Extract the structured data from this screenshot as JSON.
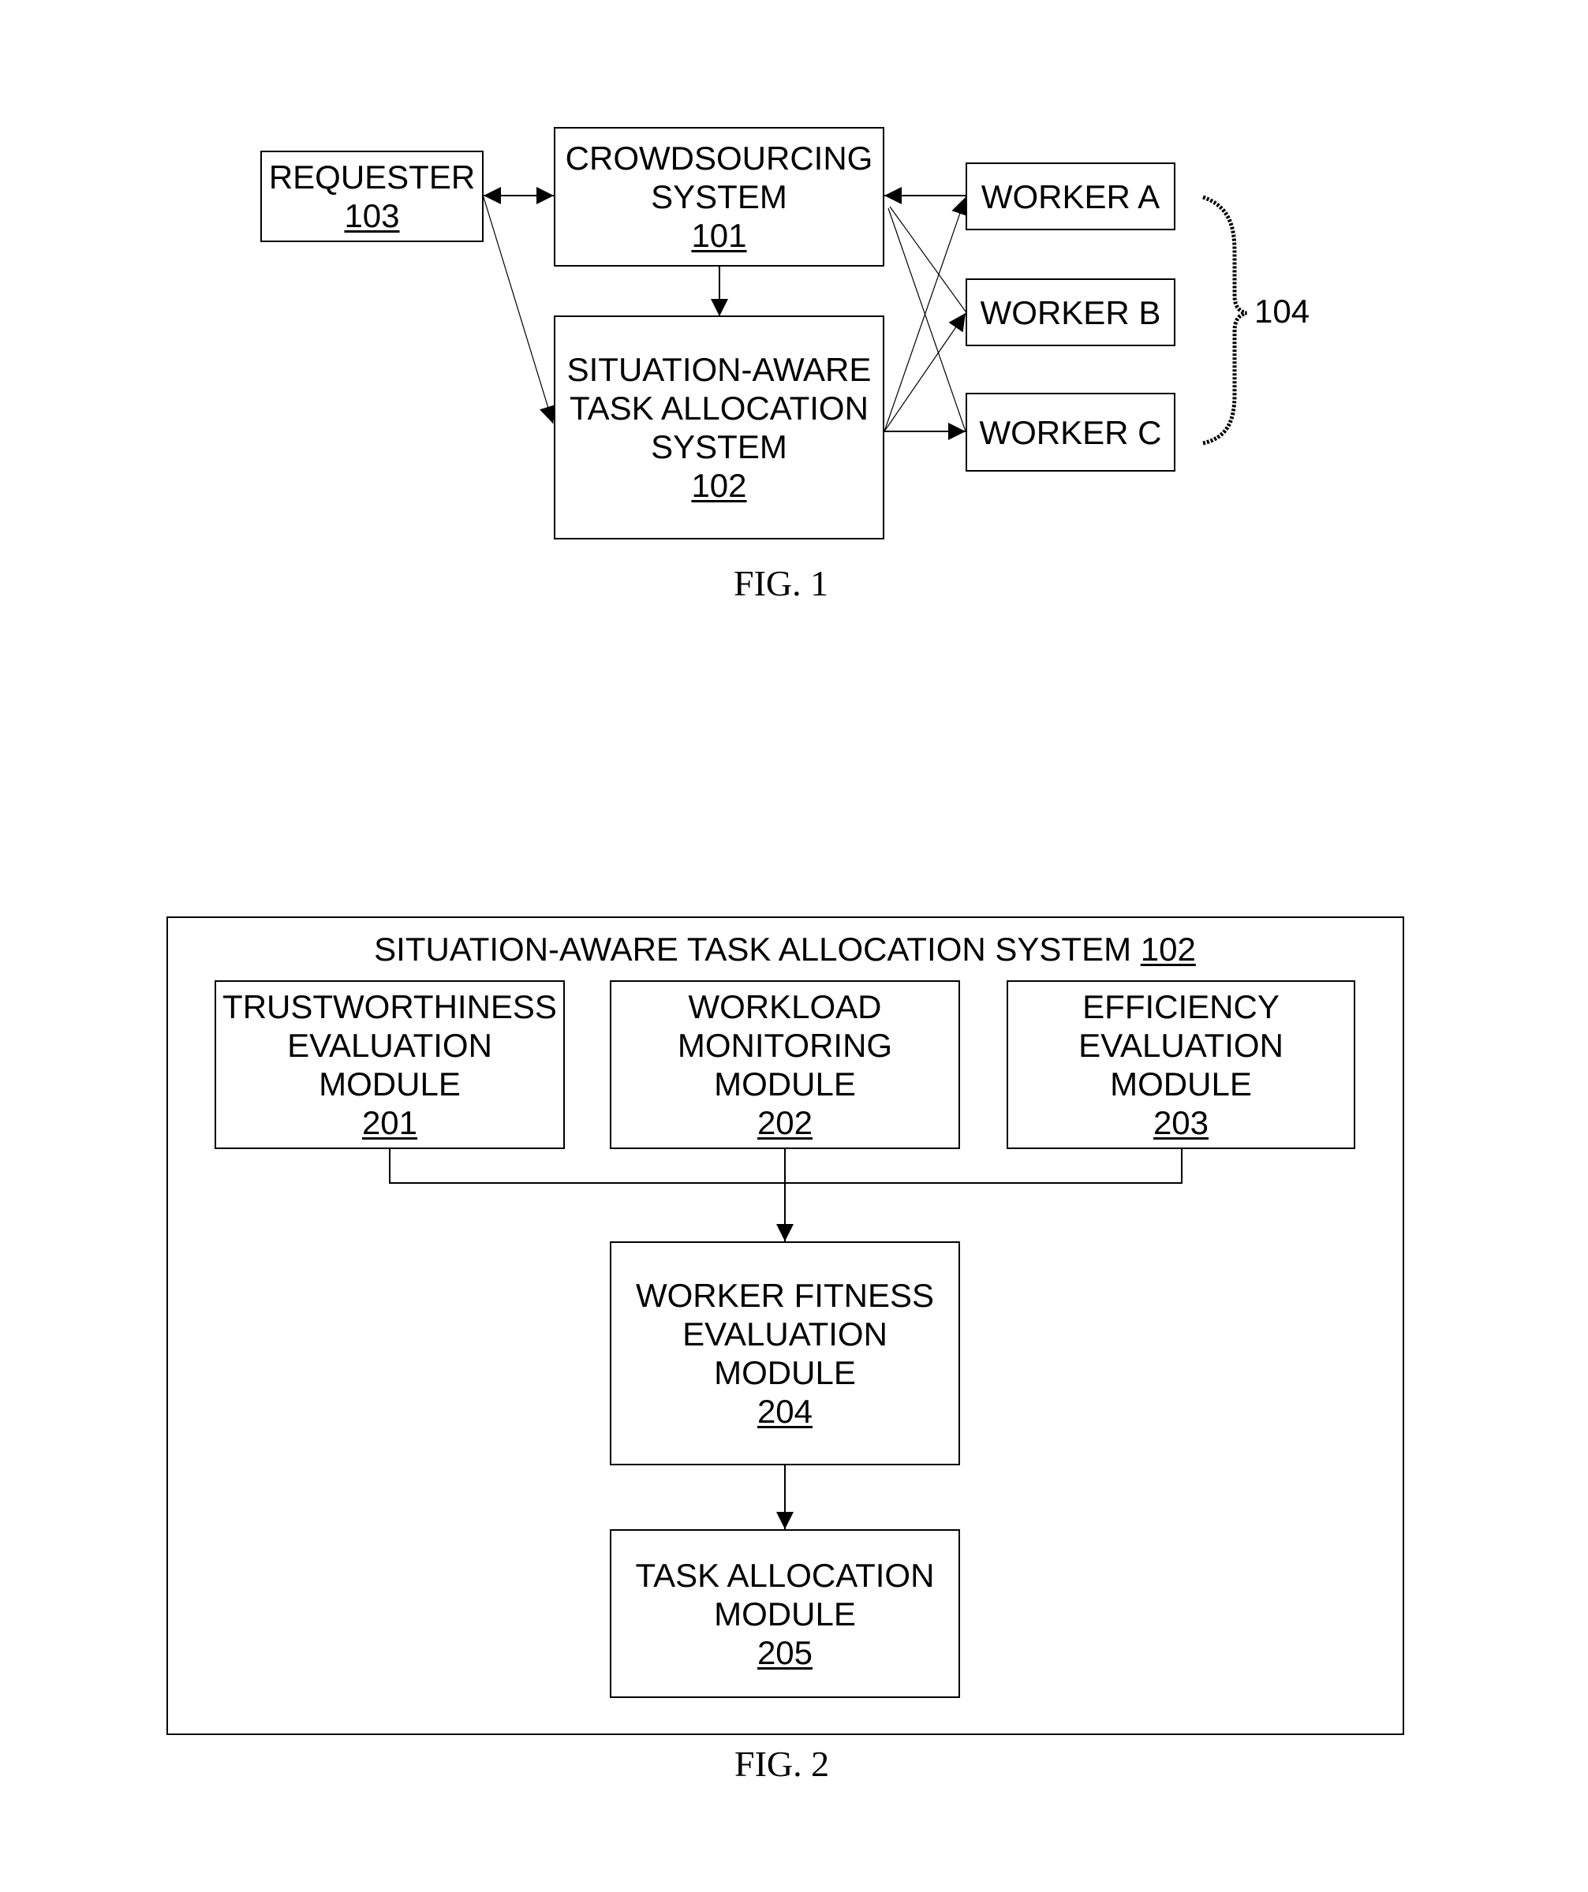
{
  "fig1": {
    "caption": "FIG. 1",
    "requester": {
      "lines": [
        "REQUESTER"
      ],
      "ref": "103"
    },
    "crowdsourcing": {
      "lines": [
        "CROWDSOURCING",
        "SYSTEM"
      ],
      "ref": "101"
    },
    "sata": {
      "lines": [
        "SITUATION-AWARE",
        "TASK ALLOCATION",
        "SYSTEM"
      ],
      "ref": "102"
    },
    "workers": [
      {
        "label": "WORKER A"
      },
      {
        "label": "WORKER B"
      },
      {
        "label": "WORKER C"
      }
    ],
    "workers_group_ref": "104"
  },
  "fig2": {
    "caption": "FIG. 2",
    "container_title": "SITUATION-AWARE TASK ALLOCATION SYSTEM",
    "container_ref": "102",
    "modules": {
      "trust": {
        "lines": [
          "TRUSTWORTHINESS",
          "EVALUATION",
          "MODULE"
        ],
        "ref": "201"
      },
      "workload": {
        "lines": [
          "WORKLOAD",
          "MONITORING",
          "MODULE"
        ],
        "ref": "202"
      },
      "efficiency": {
        "lines": [
          "EFFICIENCY",
          "EVALUATION",
          "MODULE"
        ],
        "ref": "203"
      },
      "fitness": {
        "lines": [
          "WORKER FITNESS",
          "EVALUATION",
          "MODULE"
        ],
        "ref": "204"
      },
      "allocation": {
        "lines": [
          "TASK ALLOCATION",
          "MODULE"
        ],
        "ref": "205"
      }
    }
  }
}
